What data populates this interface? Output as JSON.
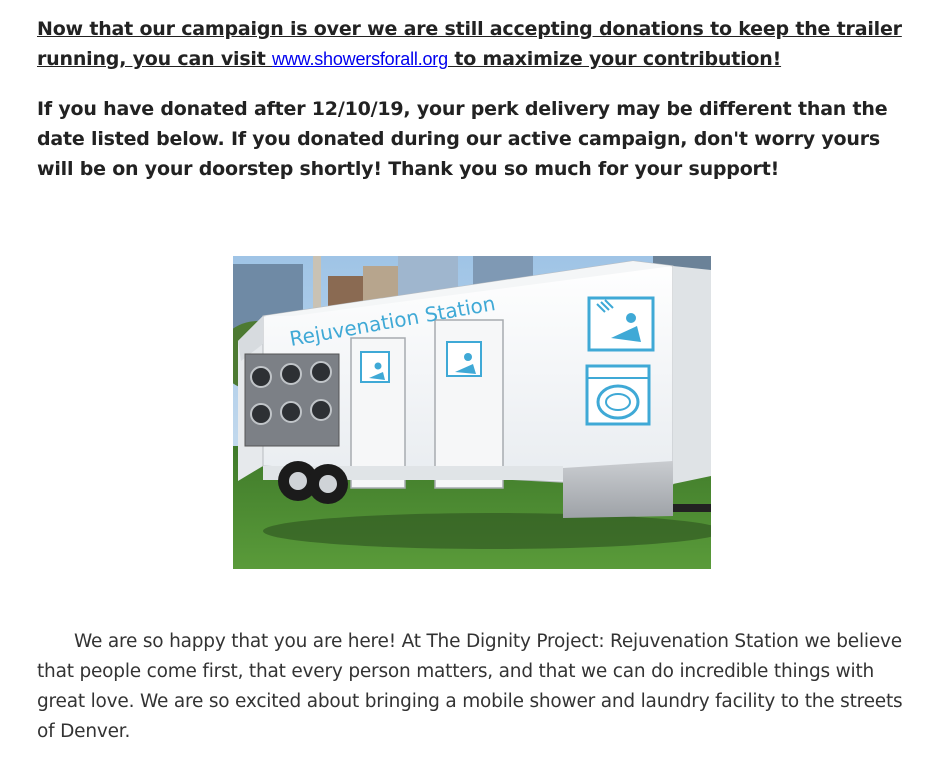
{
  "notice": {
    "text_before_link": "Now that our campaign is over we are still accepting donations to keep the trailer running, you can visit ",
    "link_text": "www.showersforall.org",
    "text_after_link": " to maximize your contribution!"
  },
  "delivery_note": "If you have donated after 12/10/19, your perk delivery may be different than the date listed below. If you donated during our active campaign, don't worry yours will be on your doorstep shortly! Thank you so much for your support!",
  "photo": {
    "trailer_lettering": "Rejuvenation Station"
  },
  "intro": "We are so happy that you are here! At The Dignity Project: Rejuvenation Station we believe that people come first, that every person matters, and that we can do incredible things with great love. We are so excited about bringing a mobile shower and laundry facility to the streets of Denver.",
  "colors": {
    "link": "#0000ee",
    "icon_blue": "#3fa9d6"
  }
}
